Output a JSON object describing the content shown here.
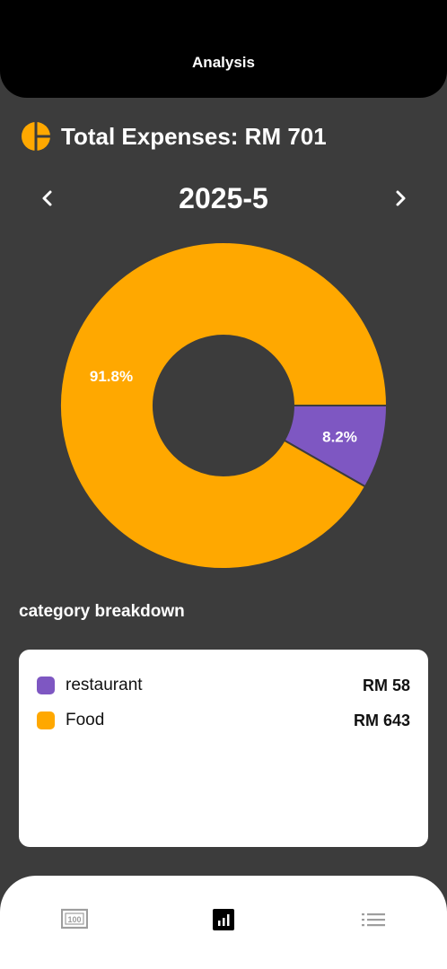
{
  "header": {
    "title": "Analysis"
  },
  "summary": {
    "total_text": "Total Expenses: RM 701",
    "icon": "pie-chart-icon"
  },
  "month_nav": {
    "label": "2025-5",
    "prev_icon": "chevron-left-icon",
    "next_icon": "chevron-right-icon"
  },
  "colors": {
    "food": "#FFA800",
    "restaurant": "#7E57C2",
    "background": "#3c3c3c"
  },
  "chart_data": {
    "type": "pie",
    "variant": "donut",
    "categories": [
      "Food",
      "restaurant"
    ],
    "values": [
      643,
      58
    ],
    "labels": [
      "91.8%",
      "8.2%"
    ],
    "colors": [
      "#FFA800",
      "#7E57C2"
    ]
  },
  "breakdown": {
    "title": "category breakdown",
    "items": [
      {
        "name": "restaurant",
        "amount": "RM 58"
      },
      {
        "name": "Food",
        "amount": "RM 643"
      }
    ]
  },
  "bottom_nav": {
    "items": [
      {
        "icon": "calendar-100-icon"
      },
      {
        "icon": "bar-chart-icon",
        "active": true
      },
      {
        "icon": "list-icon"
      }
    ]
  }
}
